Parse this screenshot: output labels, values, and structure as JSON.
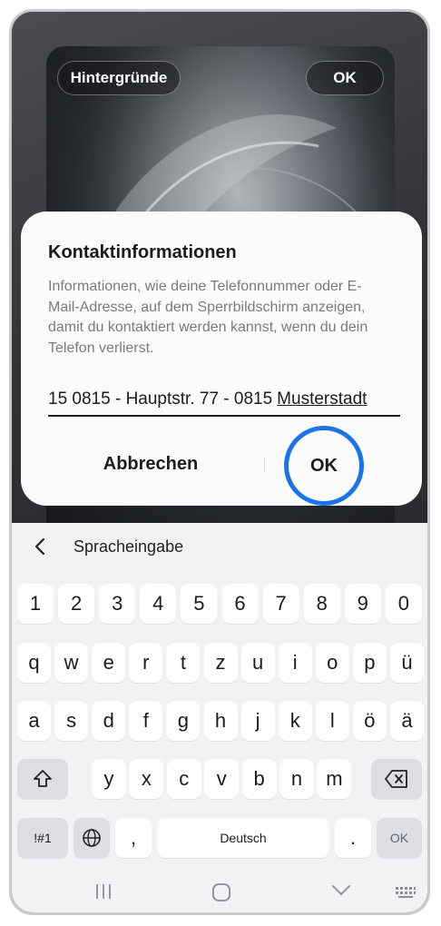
{
  "preview": {
    "wallpaper_label": "Hintergründe",
    "ok_label": "OK"
  },
  "dialog": {
    "title": "Kontaktinformationen",
    "description": "Informationen, wie deine Telefonnummer oder E-Mail-Adresse, auf dem Sperrbildschirm anzeigen, damit du kontaktiert werden kannst, wenn du dein Telefon verlierst.",
    "input_text_plain": "15 0815 - Hauptstr. 77 - 0815",
    "input_text_underlined": "Musterstadt",
    "cancel_label": "Abbrechen",
    "ok_label": "OK",
    "highlight_color": "#1a73e8"
  },
  "keyboard": {
    "suggestion": "Spracheingabe",
    "row_numbers": [
      "1",
      "2",
      "3",
      "4",
      "5",
      "6",
      "7",
      "8",
      "9",
      "0"
    ],
    "row_1": [
      "q",
      "w",
      "e",
      "r",
      "t",
      "z",
      "u",
      "i",
      "o",
      "p",
      "ü"
    ],
    "row_2": [
      "a",
      "s",
      "d",
      "f",
      "g",
      "h",
      "j",
      "k",
      "l",
      "ö",
      "ä"
    ],
    "row_3": [
      "y",
      "x",
      "c",
      "v",
      "b",
      "n",
      "m"
    ],
    "symbols_label": "!#1",
    "comma_label": ",",
    "space_label": "Deutsch",
    "period_label": ".",
    "enter_label": "OK"
  },
  "icons": {
    "back": "chevron-left-icon",
    "shift": "shift-icon",
    "backspace": "backspace-icon",
    "language": "globe-icon",
    "nav_recent": "recent-apps-icon",
    "nav_home": "home-icon",
    "nav_back": "nav-back-chevron-icon",
    "nav_keyboard": "keyboard-icon"
  }
}
